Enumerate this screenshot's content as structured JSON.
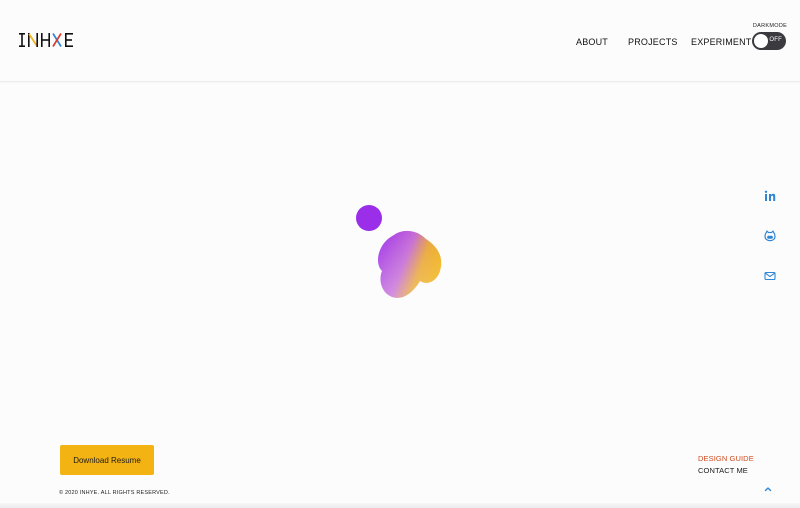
{
  "header": {
    "logo_text": "INHYE",
    "nav": [
      {
        "label": "ABOUT"
      },
      {
        "label": "PROJECTS"
      },
      {
        "label": "EXPERIMENT"
      }
    ],
    "darkmode": {
      "label": "DARKMODE",
      "state_text": "OFF",
      "is_on": false
    }
  },
  "social": [
    {
      "icon": "linkedin-icon"
    },
    {
      "icon": "github-icon"
    },
    {
      "icon": "mail-icon"
    }
  ],
  "footer": {
    "download_label": "Download Resume",
    "copyright": "© 2020 INHYE. ALL RIGHTS RESERVED.",
    "design_guide": "DESIGN GUIDE",
    "contact_me": "CONTACT ME",
    "scroll_top_icon": "chevron-up-icon"
  },
  "colors": {
    "accent_yellow": "#f3b312",
    "accent_purple": "#9b2ee8",
    "link_orange": "#cf4a1c",
    "icon_blue": "#2f86d6",
    "toggle_dark": "#3b3b3f"
  }
}
